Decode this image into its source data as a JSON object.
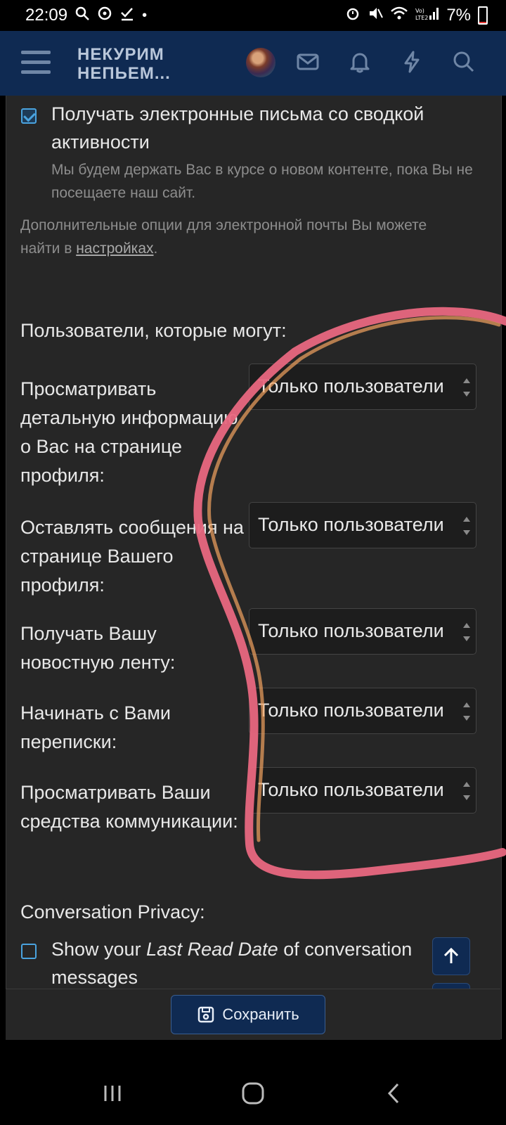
{
  "status_bar": {
    "time": "22:09",
    "battery": "7%"
  },
  "header": {
    "logo_line1": "НЕКУРИМ",
    "logo_line2": "НЕПЬЕМ..."
  },
  "email_option": {
    "label": "Получать электронные письма со сводкой активности",
    "hint": "Мы будем держать Вас в курсе о новом контенте, пока Вы не посещаете наш сайт.",
    "checked": true
  },
  "email_note": {
    "before": "Дополнительные опции для электронной почты Вы можете найти в ",
    "link": "настройках",
    "after": "."
  },
  "privacy": {
    "heading": "Пользователи, которые могут:",
    "rows": [
      {
        "label": "Просматривать детальную информацию о Вас на странице профиля:",
        "value": "Только пользователи"
      },
      {
        "label": "Оставлять сообщения на странице Вашего профиля:",
        "value": "Только пользователи"
      },
      {
        "label": "Получать Вашу новостную ленту:",
        "value": "Только пользователи"
      },
      {
        "label": "Начинать с Вами переписки:",
        "value": "Только пользователи"
      },
      {
        "label": "Просматривать Ваши средства коммуникации:",
        "value": "Только пользователи"
      }
    ]
  },
  "conversation": {
    "heading": "Conversation Privacy:",
    "option_prefix": "Show your ",
    "option_em": "Last Read Date",
    "option_suffix": " of conversation messages",
    "checked": false
  },
  "save": {
    "label": "Сохранить"
  },
  "annotation_color": "#e8677f"
}
